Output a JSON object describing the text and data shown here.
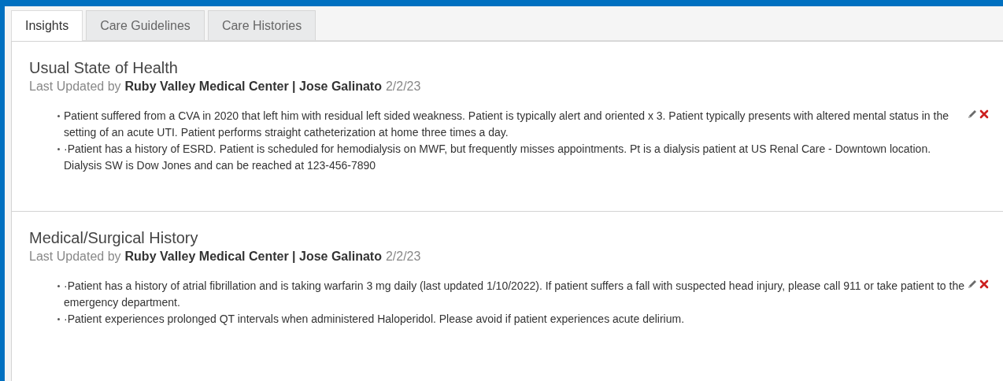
{
  "tabs": [
    {
      "label": "Insights",
      "selected": true
    },
    {
      "label": "Care Guidelines",
      "selected": false
    },
    {
      "label": "Care Histories",
      "selected": false
    }
  ],
  "sections": [
    {
      "title": "Usual State of Health",
      "updated_prefix": "Last Updated by",
      "updated_by": "Ruby Valley Medical Center | Jose Galinato",
      "updated_date": "2/2/23",
      "items": [
        "Patient suffered from a CVA in 2020 that left him with residual left sided weakness. Patient is typically alert and oriented x 3. Patient typically presents with altered mental status in the setting of an acute UTI. Patient performs straight catheterization at home three times a day.",
        "·Patient has a history of ESRD. Patient is scheduled for hemodialysis on MWF, but frequently misses appointments. Pt is a dialysis patient at US Renal Care - Downtown location. Dialysis SW is Dow Jones and can be reached at 123-456-7890"
      ]
    },
    {
      "title": "Medical/Surgical History",
      "updated_prefix": "Last Updated by",
      "updated_by": "Ruby Valley Medical Center | Jose Galinato",
      "updated_date": "2/2/23",
      "items": [
        "·Patient has a history of atrial fibrillation and is taking warfarin 3 mg daily (last updated 1/10/2022). If patient suffers a fall with suspected head injury, please call 911 or take patient to the emergency department.",
        "·Patient experiences prolonged QT intervals when administered Haloperidol. Please avoid if patient experiences acute delirium."
      ]
    }
  ]
}
